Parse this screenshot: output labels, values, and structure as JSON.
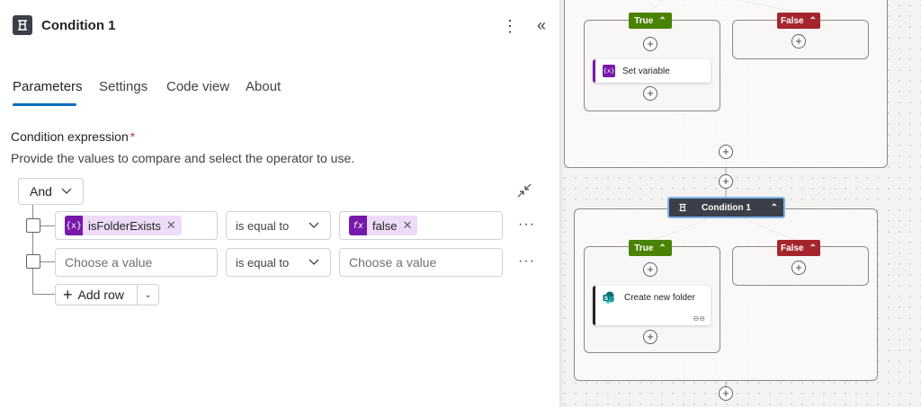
{
  "header": {
    "title": "Condition 1",
    "more_glyph": "⋮",
    "collapse_glyph": "«"
  },
  "tabs": [
    {
      "label": "Parameters",
      "active": true
    },
    {
      "label": "Settings"
    },
    {
      "label": "Code view"
    },
    {
      "label": "About"
    }
  ],
  "condition": {
    "label": "Condition expression",
    "required_mark": "*",
    "description": "Provide the values to compare and select the operator to use.",
    "group_operator": "And",
    "rows": [
      {
        "left_token": {
          "icon": "{x}",
          "label": "isFolderExists"
        },
        "operator": "is equal to",
        "right_token": {
          "icon": "fx",
          "label": "false"
        }
      },
      {
        "left_placeholder": "Choose a value",
        "operator": "is equal to",
        "right_placeholder": "Choose a value"
      }
    ],
    "add_row_label": "Add row",
    "row_menu_glyph": "···"
  },
  "canvas": {
    "true_label": "True",
    "false_label": "False",
    "set_variable_label": "Set variable",
    "set_variable_icon": "{x}",
    "condition_node_label": "Condition 1",
    "create_folder_label": "Create new folder"
  },
  "colors": {
    "accent": "#0f6cbd",
    "true_branch": "#498205",
    "false_branch": "#a4262c",
    "variable_token": "#7719aa"
  }
}
